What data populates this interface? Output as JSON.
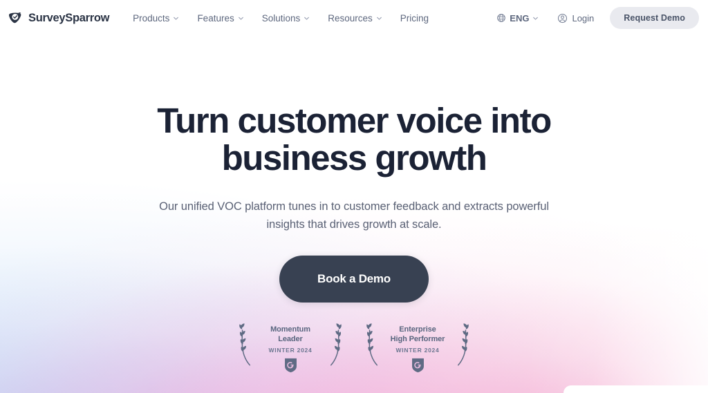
{
  "brand": {
    "name": "SurveySparrow",
    "logo_icon": "surveysparrow-shield-icon"
  },
  "nav": {
    "items": [
      {
        "label": "Products",
        "has_chevron": true
      },
      {
        "label": "Features",
        "has_chevron": true
      },
      {
        "label": "Solutions",
        "has_chevron": true
      },
      {
        "label": "Resources",
        "has_chevron": true
      },
      {
        "label": "Pricing",
        "has_chevron": false
      }
    ]
  },
  "header_right": {
    "language": {
      "label": "ENG",
      "icon": "globe-icon",
      "chevron": "chevron-down-icon"
    },
    "login": {
      "label": "Login",
      "icon": "user-circle-icon"
    },
    "request_demo": {
      "label": "Request Demo"
    }
  },
  "hero": {
    "title_line1": "Turn customer voice into",
    "title_line2": "business growth",
    "subtitle_line1": "Our unified VOC platform tunes in to customer feedback and extracts",
    "subtitle_line2": "powerful insights that drives growth at scale.",
    "cta_label": "Book a Demo"
  },
  "badges": [
    {
      "title_line1": "Momentum",
      "title_line2": "Leader",
      "period": "WINTER 2024",
      "logo_icon": "g2-shield-icon"
    },
    {
      "title_line1": "Enterprise",
      "title_line2": "High Performer",
      "period": "WINTER 2024",
      "logo_icon": "g2-shield-icon"
    }
  ],
  "colors": {
    "headline": "#1b2235",
    "body_text": "#5a6175",
    "nav_text": "#5d677e",
    "cta_bg": "#384152",
    "request_demo_bg": "#e9eaef",
    "badge_text": "#58657e",
    "gradient_blue": "#96bef0",
    "gradient_lilac": "#cdb2ec",
    "gradient_pink": "#f396d4"
  }
}
